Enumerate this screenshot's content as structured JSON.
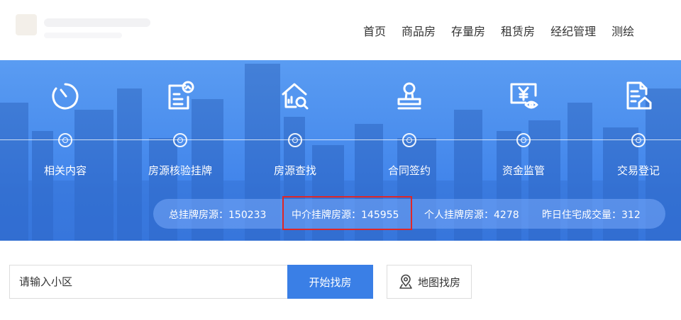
{
  "header": {
    "nav": [
      {
        "label": "首页"
      },
      {
        "label": "商品房"
      },
      {
        "label": "存量房"
      },
      {
        "label": "租赁房"
      },
      {
        "label": "经纪管理"
      },
      {
        "label": "测绘"
      }
    ]
  },
  "banner": {
    "steps": [
      {
        "label": "相关内容",
        "icon": "clock-icon"
      },
      {
        "label": "房源核验挂牌",
        "icon": "document-verify-icon"
      },
      {
        "label": "房源查找",
        "icon": "house-search-icon"
      },
      {
        "label": "合同签约",
        "icon": "seal-stamp-icon"
      },
      {
        "label": "资金监管",
        "icon": "yuan-monitor-icon"
      },
      {
        "label": "交易登记",
        "icon": "file-house-icon"
      }
    ],
    "stats": {
      "total": "总挂牌房源：150233",
      "agency": "中介挂牌房源：145955",
      "personal": "个人挂牌房源：4278",
      "yesterday": "昨日住宅成交量：312"
    },
    "highlight_color": "#e02626"
  },
  "search": {
    "placeholder": "请输入小区",
    "submit_label": "开始找房",
    "map_label": "地图找房",
    "map_icon": "location-pin-icon"
  },
  "colors": {
    "accent": "#3a7fe6",
    "banner": "#4c8fee"
  }
}
